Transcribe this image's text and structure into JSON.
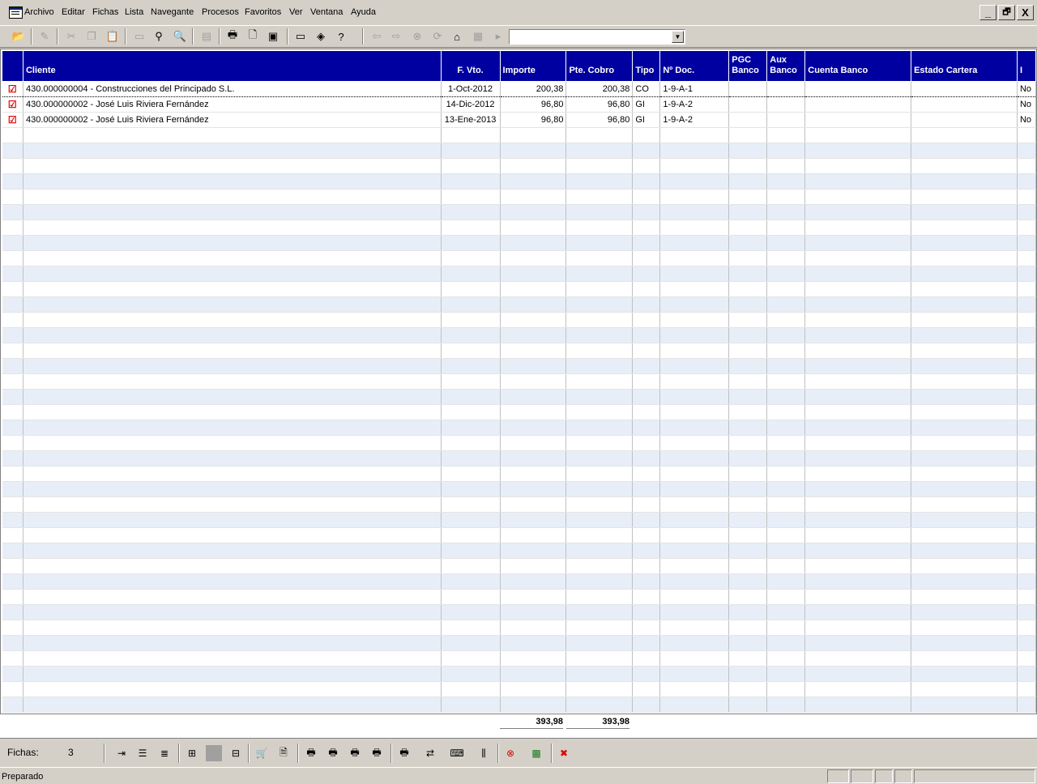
{
  "menu": [
    "Archivo",
    "Editar",
    "Fichas",
    "Lista",
    "Navegante",
    "Procesos",
    "Favoritos",
    "Ver",
    "Ventana",
    "Ayuda"
  ],
  "window_controls": [
    "_",
    "🗗",
    "X"
  ],
  "toolbar_icons": [
    "open-folder-icon",
    "edit-icon",
    "cut-icon",
    "copy-icon",
    "paste-icon",
    "window-icon",
    "binoculars-icon",
    "search-icon",
    "calculator-icon",
    "print-icon",
    "print-preview-icon",
    "page-icon",
    "monitor-icon",
    "tag-icon",
    "help-icon",
    "back-arrow-icon",
    "forward-arrow-icon",
    "stop-icon",
    "refresh-icon",
    "home-icon",
    "favorites-icon",
    "go-icon"
  ],
  "combo_value": "",
  "columns": [
    "",
    "Cliente",
    "F. Vto.",
    "Importe",
    "Pte. Cobro",
    "Tipo",
    "Nº Doc.",
    "PGC Banco",
    "Aux Banco",
    "Cuenta Banco",
    "Estado Cartera",
    "I"
  ],
  "rows": [
    {
      "checked": true,
      "cliente": "430.000000004 - Construcciones del Principado S.L.",
      "fvto": "1-Oct-2012",
      "importe": "200,38",
      "pte": "200,38",
      "tipo": "CO",
      "doc": "1-9-A-1",
      "pgc": "",
      "aux": "",
      "cuenta": "",
      "estado": "",
      "i": "No"
    },
    {
      "checked": true,
      "cliente": "430.000000002 - José Luis Riviera Fernández",
      "fvto": "14-Dic-2012",
      "importe": "96,80",
      "pte": "96,80",
      "tipo": "GI",
      "doc": "1-9-A-2",
      "pgc": "",
      "aux": "",
      "cuenta": "",
      "estado": "",
      "i": "No"
    },
    {
      "checked": true,
      "cliente": "430.000000002 - José Luis Riviera Fernández",
      "fvto": "13-Ene-2013",
      "importe": "96,80",
      "pte": "96,80",
      "tipo": "GI",
      "doc": "1-9-A-2",
      "pgc": "",
      "aux": "",
      "cuenta": "",
      "estado": "",
      "i": "No"
    }
  ],
  "totals": {
    "importe": "393,98",
    "pte": "393,98"
  },
  "fichas_label": "Fichas:",
  "fichas_count": "3",
  "status": "Preparado",
  "colors": {
    "header_bg": "#0000a0",
    "alt_row": "#e8eef8",
    "check": "#e00000",
    "chrome": "#d4d0c8"
  }
}
